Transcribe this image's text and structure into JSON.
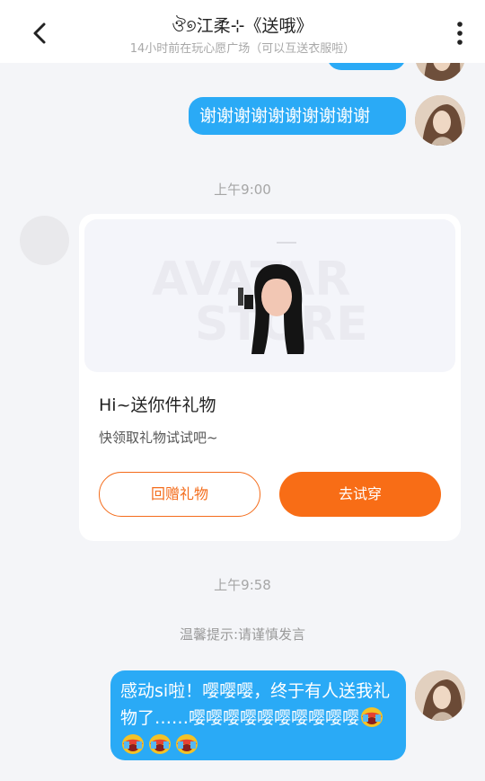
{
  "header": {
    "title": "ঔ୭江柔⊹《送哦》",
    "subtitle": "14小时前在玩心愿广场（可以互送衣服啦）"
  },
  "messages": {
    "sent_1": "谢谢谢谢谢谢谢谢谢谢",
    "time_1": "上午9:00",
    "time_2": "上午9:58",
    "tip": "温馨提示:请谨慎发言",
    "sent_2": "感动si啦！嘤嘤嘤，终于有人送我礼物了……嘤嘤嘤嘤嘤嘤嘤嘤嘤嘤"
  },
  "gift_card": {
    "watermark_line1": "AVATAR",
    "watermark_line2": "STORE",
    "title": "Hi~送你件礼物",
    "subtitle": "快领取礼物试试吧~",
    "return_gift_label": "回赠礼物",
    "try_on_label": "去试穿"
  },
  "icons": {
    "back": "chevron-left-icon",
    "more": "vertical-ellipsis-icon",
    "emoji": "crying-face-icon"
  },
  "colors": {
    "bubble": "#2aaaf6",
    "accent": "#f86d16"
  }
}
